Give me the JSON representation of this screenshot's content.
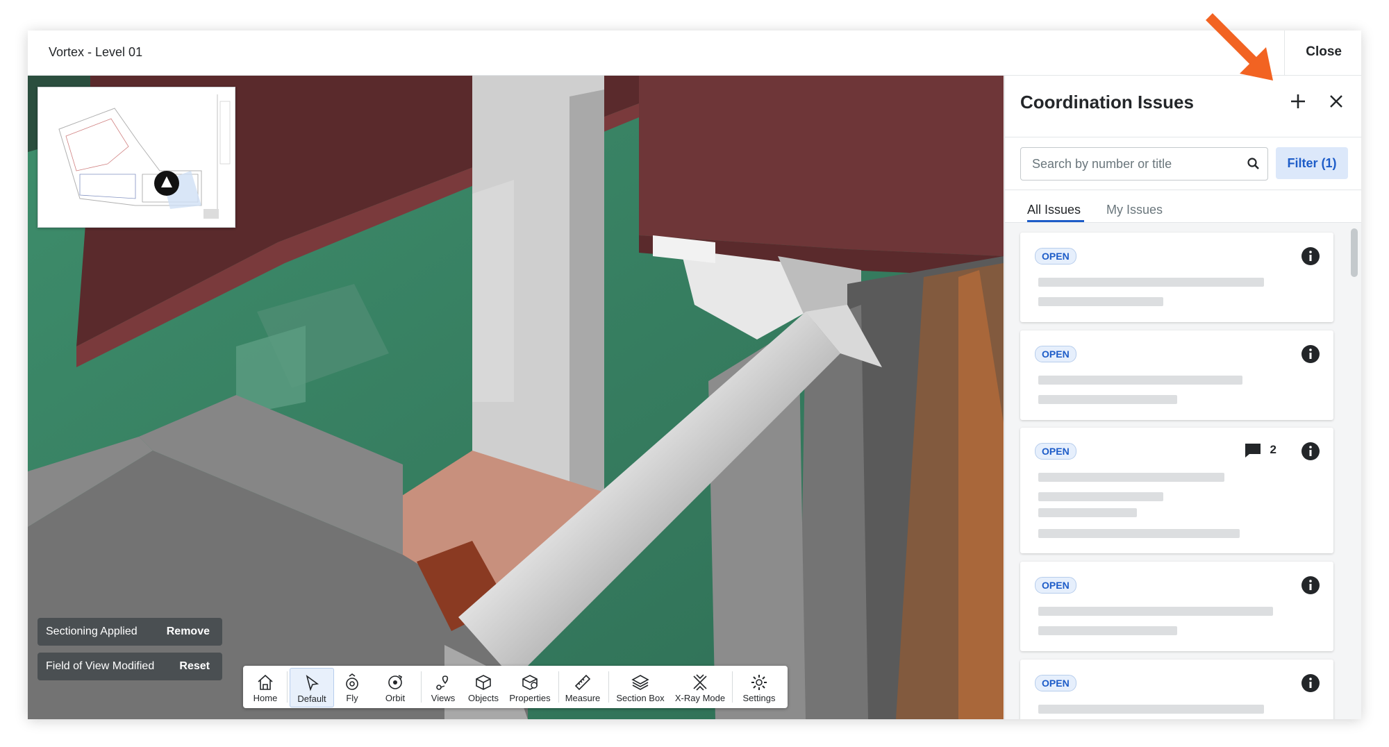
{
  "window": {
    "title": "Vortex - Level 01",
    "close_label": "Close"
  },
  "viewer": {
    "status": [
      {
        "label": "Sectioning Applied",
        "action": "Remove"
      },
      {
        "label": "Field of View Modified",
        "action": "Reset"
      }
    ],
    "toolbar": [
      {
        "label": "Home",
        "icon": "home-icon"
      },
      {
        "label": "Default",
        "icon": "cursor-icon",
        "active": true
      },
      {
        "label": "Fly",
        "icon": "fly-icon"
      },
      {
        "label": "Orbit",
        "icon": "orbit-icon"
      },
      {
        "label": "Views",
        "icon": "views-icon"
      },
      {
        "label": "Objects",
        "icon": "objects-icon"
      },
      {
        "label": "Properties",
        "icon": "properties-icon"
      },
      {
        "label": "Measure",
        "icon": "ruler-icon"
      },
      {
        "label": "Section Box",
        "icon": "section-box-icon"
      },
      {
        "label": "X-Ray Mode",
        "icon": "xray-icon"
      },
      {
        "label": "Settings",
        "icon": "gear-icon"
      }
    ]
  },
  "panel": {
    "title": "Coordination Issues",
    "search_placeholder": "Search by number or title",
    "filter_label": "Filter (1)",
    "tabs": [
      "All Issues",
      "My Issues"
    ],
    "issues": [
      {
        "status": "OPEN",
        "comments": null
      },
      {
        "status": "OPEN",
        "comments": null
      },
      {
        "status": "OPEN",
        "comments": "2"
      },
      {
        "status": "OPEN",
        "comments": null
      },
      {
        "status": "OPEN",
        "comments": null
      }
    ]
  },
  "colors": {
    "accent": "#1d5cc8",
    "callout_arrow": "#f26322",
    "beam": "#6a3537",
    "glass": "#3f8a6c"
  }
}
